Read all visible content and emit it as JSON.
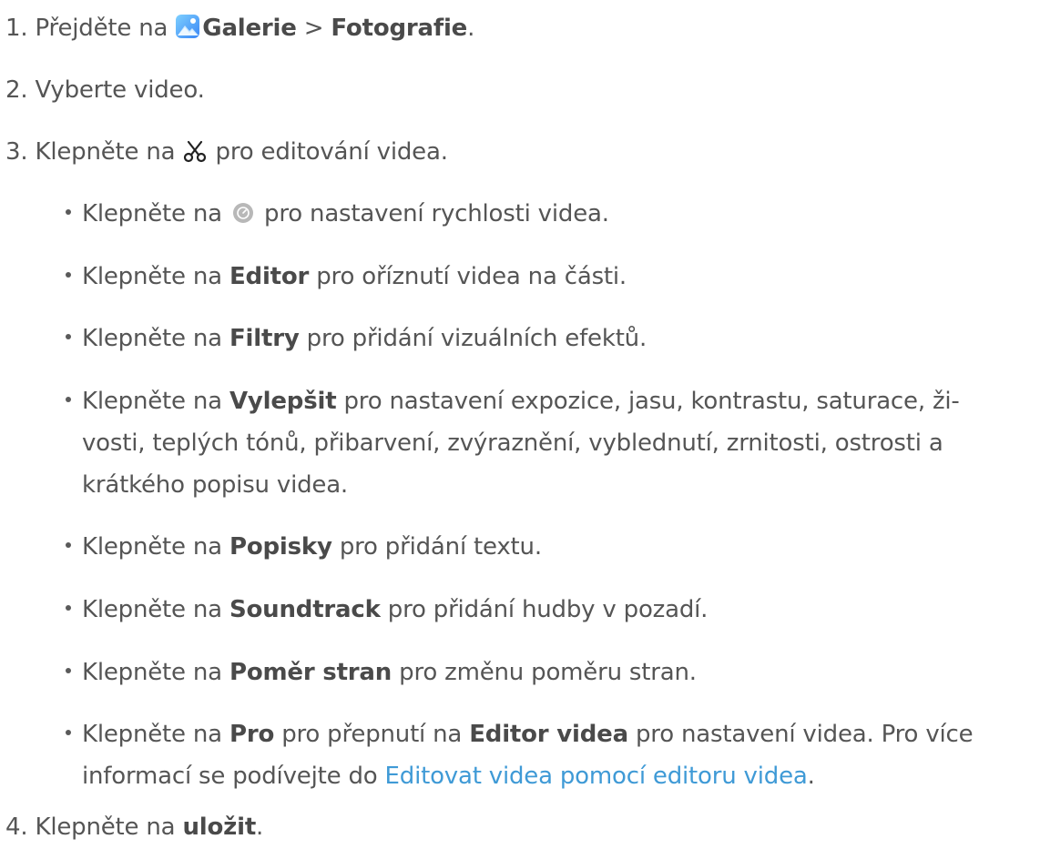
{
  "steps": [
    {
      "num": "1.",
      "pre": "Přejděte na ",
      "b1": "Galerie",
      "mid": " > ",
      "b2": "Fotografie",
      "post": "."
    },
    {
      "num": "2.",
      "text": "Vyberte video."
    },
    {
      "num": "3.",
      "pre": "Klepněte na ",
      "post": " pro editování videa."
    },
    {
      "num": "4.",
      "pre": "Klepněte na ",
      "b": "uložit",
      "post": "."
    }
  ],
  "bullets": [
    {
      "pre": "Klepněte na ",
      "post": " pro nastavení rychlosti videa."
    },
    {
      "pre": "Klepněte na ",
      "b": "Editor",
      "post": " pro oříznutí videa na části."
    },
    {
      "pre": "Klepněte na ",
      "b": "Filtry",
      "post": " pro přidání vizuálních efektů."
    },
    {
      "pre": "Klepněte na ",
      "b": "Vylepšit",
      "post": " pro nastavení expozice, jasu, kontrastu, saturace, ži-",
      "cont1": "vosti, teplých tónů, přibarvení, zvýraznění, vyblednutí, zrnitosti, ostrosti a",
      "cont2": "krátkého popisu videa."
    },
    {
      "pre": "Klepněte na ",
      "b": "Popisky",
      "post": " pro přidání textu."
    },
    {
      "pre": "Klepněte na ",
      "b": "Soundtrack",
      "post": " pro přidání hudby v pozadí."
    },
    {
      "pre": "Klepněte na ",
      "b": "Poměr stran",
      "post": " pro změnu poměru stran."
    },
    {
      "pre": "Klepněte na ",
      "b": "Pro",
      "mid": " pro přepnutí na ",
      "b2": "Editor videa",
      "post": " pro nastavení videa. Pro více",
      "cont1": "informací se podívejte do ",
      "link": "Editovat videa pomocí editoru videa",
      "cont1_post": "."
    }
  ],
  "icons": {
    "gallery": "gallery-app-icon",
    "edit": "scissors-icon",
    "speed": "speed-dial-icon"
  },
  "colors": {
    "text": "#555555",
    "link": "#3f9ad6"
  }
}
